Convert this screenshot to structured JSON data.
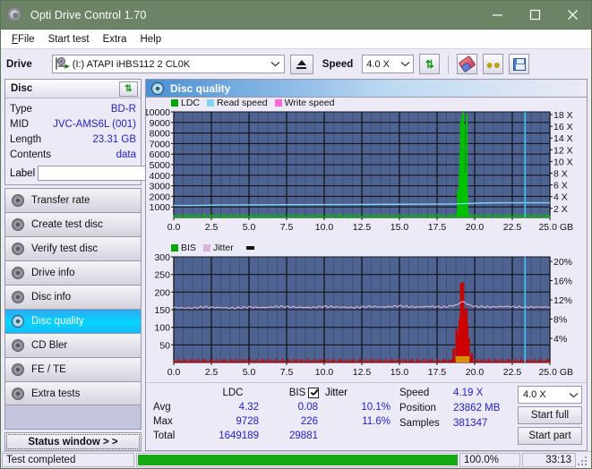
{
  "window": {
    "title": "Opti Drive Control 1.70",
    "app_icon": "disc-icon",
    "minimize": "minimize-icon",
    "maximize": "maximize-icon",
    "close": "close-icon"
  },
  "menu": {
    "items": [
      {
        "label": "File",
        "accel": "F"
      },
      {
        "label": "Start test",
        "accel": "S"
      },
      {
        "label": "Extra",
        "accel": "x"
      },
      {
        "label": "Help",
        "accel": "H"
      }
    ]
  },
  "toolbar": {
    "drive_label": "Drive",
    "drive_value": "(I:)   ATAPI iHBS112  2 CL0K",
    "eject_icon": "eject-icon",
    "speed_label": "Speed",
    "speed_value": "4.0 X",
    "refresh_icon": "refresh-icon",
    "erase_icon": "eraser-icon",
    "disc_tool_icon": "disc-tools-icon",
    "save_icon": "save-icon"
  },
  "disc_panel": {
    "title": "Disc",
    "refresh_icon": "refresh-icon",
    "rows": [
      {
        "key": "Type",
        "value": "BD-R"
      },
      {
        "key": "MID",
        "value": "JVC-AMS6L (001)"
      },
      {
        "key": "Length",
        "value": "23.31 GB"
      },
      {
        "key": "Contents",
        "value": "data"
      }
    ],
    "label_key": "Label",
    "label_value": "",
    "label_button_icon": "disc-label-icon"
  },
  "sidebar": {
    "items": [
      {
        "label": "Transfer rate",
        "icon": "disc-icon",
        "active": false
      },
      {
        "label": "Create test disc",
        "icon": "disc-icon",
        "active": false
      },
      {
        "label": "Verify test disc",
        "icon": "disc-icon",
        "active": false
      },
      {
        "label": "Drive info",
        "icon": "disc-icon",
        "active": false
      },
      {
        "label": "Disc info",
        "icon": "disc-icon",
        "active": false
      },
      {
        "label": "Disc quality",
        "icon": "disc-icon",
        "active": true
      },
      {
        "label": "CD Bler",
        "icon": "disc-icon",
        "active": false
      },
      {
        "label": "FE / TE",
        "icon": "disc-icon",
        "active": false
      },
      {
        "label": "Extra tests",
        "icon": "disc-icon",
        "active": false
      }
    ],
    "status_window_button": "Status window > >"
  },
  "main": {
    "title": "Disc quality",
    "icon": "disc-icon"
  },
  "stats": {
    "col_headers": [
      "LDC",
      "BIS"
    ],
    "rows": [
      {
        "label": "Avg",
        "ldc": "4.32",
        "bis": "0.08",
        "jitter": "10.1%"
      },
      {
        "label": "Max",
        "ldc": "9728",
        "bis": "226",
        "jitter": "11.6%"
      },
      {
        "label": "Total",
        "ldc": "1649189",
        "bis": "29881",
        "jitter": ""
      }
    ],
    "jitter_label": "Jitter",
    "jitter_checked": true,
    "speed_label": "Speed",
    "speed_value": "4.19 X",
    "position_label": "Position",
    "position_value": "23862 MB",
    "samples_label": "Samples",
    "samples_value": "381347",
    "speed_select": "4.0 X",
    "start_full_button": "Start full",
    "start_part_button": "Start part"
  },
  "statusbar": {
    "message": "Test completed",
    "progress_percent": 100,
    "percent_text": "100.0%",
    "elapsed": "33:13"
  },
  "colors": {
    "titlebar": "#6d8365",
    "plot_bg": "#4e6391",
    "grid": "#2b2b33",
    "ldc_green": "#00c000",
    "bis_red": "#cc0000",
    "read_speed": "#7fd4f0",
    "write_speed": "#ff66dd",
    "jitter_pink": "#d9b4dd",
    "accent_blue": "#2222cc",
    "progress_green": "#16a916"
  },
  "chart_data": [
    {
      "type": "area",
      "id": "ldc-chart",
      "title": "",
      "xlabel": "GB",
      "ylabel": "",
      "xlim": [
        0.0,
        25.0
      ],
      "xticks": [
        "0.0",
        "2.5",
        "5.0",
        "7.5",
        "10.0",
        "12.5",
        "15.0",
        "17.5",
        "20.0",
        "22.5",
        "25.0 GB"
      ],
      "ylim": [
        0,
        10000
      ],
      "yticks": [
        "10000",
        "9000",
        "8000",
        "7000",
        "6000",
        "5000",
        "4000",
        "3000",
        "2000",
        "1000"
      ],
      "y2lim": [
        0,
        18
      ],
      "y2ticks": [
        "18 X",
        "16 X",
        "14 X",
        "12 X",
        "10 X",
        "8 X",
        "6 X",
        "4 X",
        "2 X"
      ],
      "grid": true,
      "legend": [
        "LDC",
        "Read speed",
        "Write speed"
      ],
      "legend_position": "top-left",
      "series": [
        {
          "name": "LDC",
          "color": "#00c000",
          "kind": "impulse",
          "x": [
            0.1,
            0.5,
            1.0,
            1.6,
            2.2,
            2.8,
            3.4,
            4.0,
            4.6,
            5.2,
            5.8,
            6.4,
            7.0,
            7.6,
            8.2,
            8.8,
            9.4,
            10.0,
            10.6,
            11.2,
            11.8,
            12.4,
            13.0,
            13.6,
            14.2,
            14.8,
            15.4,
            16.0,
            16.6,
            17.2,
            17.8,
            18.4,
            18.9,
            19.1,
            19.2,
            19.3,
            19.4,
            19.5,
            19.7,
            20.2,
            20.8,
            21.4,
            22.0,
            22.6,
            23.2,
            23.8,
            24.4,
            24.9
          ],
          "values": [
            60,
            55,
            70,
            62,
            58,
            65,
            90,
            75,
            60,
            68,
            120,
            72,
            64,
            58,
            88,
            70,
            66,
            74,
            60,
            150,
            70,
            62,
            58,
            66,
            72,
            64,
            210,
            70,
            60,
            340,
            80,
            70,
            2600,
            9100,
            9728,
            8800,
            4200,
            2100,
            260,
            70,
            64,
            60,
            140,
            90,
            70,
            66,
            60,
            58
          ]
        },
        {
          "name": "Read speed",
          "color": "#7fd4f0",
          "kind": "line",
          "x": [
            0.0,
            1.5,
            3.0,
            5.0,
            7.5,
            10.0,
            12.5,
            15.0,
            17.0,
            18.5,
            19.0,
            20.5,
            22.0,
            23.3,
            23.4,
            25.0
          ],
          "values": [
            2.05,
            2.05,
            2.12,
            2.15,
            2.18,
            2.2,
            2.22,
            2.25,
            2.28,
            2.3,
            2.33,
            2.48,
            2.5,
            2.5,
            2.5,
            2.5
          ]
        },
        {
          "name": "Write speed",
          "color": "#ff66dd",
          "kind": "line",
          "x": [],
          "values": []
        },
        {
          "name": "marker",
          "color": "#36c8ef",
          "kind": "vline",
          "x": [
            23.35
          ],
          "values": []
        }
      ]
    },
    {
      "type": "area",
      "id": "bis-chart",
      "title": "",
      "xlabel": "GB",
      "ylabel": "",
      "xlim": [
        0.0,
        25.0
      ],
      "xticks": [
        "0.0",
        "2.5",
        "5.0",
        "7.5",
        "10.0",
        "12.5",
        "15.0",
        "17.5",
        "20.0",
        "22.5",
        "25.0 GB"
      ],
      "ylim": [
        0,
        300
      ],
      "yticks": [
        "300",
        "250",
        "200",
        "150",
        "100",
        "50"
      ],
      "y2lim": [
        0,
        20
      ],
      "y2ticks": [
        "20%",
        "16%",
        "12%",
        "8%",
        "4%"
      ],
      "grid": true,
      "legend": [
        "BIS",
        "Jitter"
      ],
      "legend_position": "top-left",
      "series": [
        {
          "name": "BIS",
          "color": "#cc0000",
          "kind": "impulse",
          "x": [
            0.2,
            1.0,
            2.0,
            3.0,
            4.0,
            5.0,
            6.0,
            7.0,
            8.0,
            9.0,
            10.0,
            11.0,
            12.0,
            13.0,
            14.0,
            15.0,
            16.0,
            17.0,
            18.0,
            18.6,
            18.8,
            19.0,
            19.1,
            19.2,
            19.3,
            19.4,
            19.5,
            19.6,
            19.8,
            20.4,
            21.0,
            22.0,
            23.0,
            24.0,
            24.8
          ],
          "values": [
            3,
            2,
            3,
            2,
            4,
            2,
            3,
            2,
            3,
            4,
            2,
            3,
            2,
            4,
            3,
            2,
            3,
            4,
            8,
            40,
            95,
            120,
            226,
            180,
            150,
            132,
            110,
            70,
            26,
            4,
            3,
            2,
            3,
            2,
            2
          ]
        },
        {
          "name": "Jitter",
          "color": "#d9b4dd",
          "kind": "line",
          "x": [
            0.0,
            1.0,
            2.0,
            3.0,
            4.0,
            5.0,
            6.0,
            7.0,
            8.0,
            9.0,
            10.0,
            11.0,
            12.0,
            13.0,
            14.0,
            15.0,
            16.0,
            17.0,
            18.0,
            18.8,
            19.2,
            19.6,
            20.0,
            21.0,
            22.0,
            23.0,
            23.3,
            24.0,
            25.0
          ],
          "values": [
            10.4,
            10.3,
            10.5,
            10.4,
            10.3,
            10.5,
            10.4,
            10.6,
            10.5,
            10.4,
            10.6,
            10.5,
            10.4,
            10.6,
            10.5,
            10.7,
            10.5,
            10.6,
            10.5,
            10.9,
            11.6,
            10.9,
            10.6,
            10.5,
            10.6,
            10.5,
            10.5,
            10.5,
            10.5
          ]
        },
        {
          "name": "marker",
          "color": "#36c8ef",
          "kind": "vline",
          "x": [
            23.35
          ],
          "values": []
        }
      ]
    }
  ]
}
